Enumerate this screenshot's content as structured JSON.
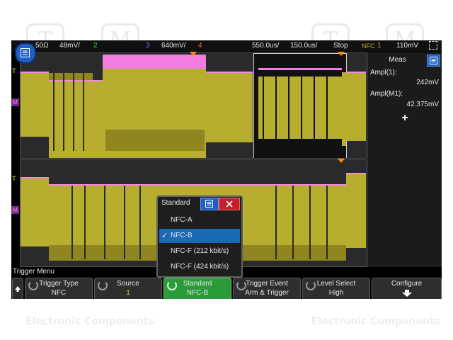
{
  "status": {
    "ch1_num": "1",
    "impedance": "50Ω",
    "ch1_scale": "48mV/",
    "ch2": "2",
    "ch3": "3",
    "ch4_scale": "640mV/",
    "ch4": "4",
    "time_pos": "550.0us/",
    "time_div": "150.0us/",
    "run_state": "Stop",
    "trig_mode": "NFC",
    "trig_src": "1",
    "trig_level": "110mV"
  },
  "meas": {
    "title": "Meas",
    "m1_label": "Ampl(1):",
    "m1_value": "242mV",
    "m2_label": "Ampl(M1):",
    "m2_value": "42.375mV",
    "add": "+"
  },
  "dialog": {
    "title": "Standard",
    "options": [
      "NFC-A",
      "NFC-B",
      "NFC-F (212 kbit/s)",
      "NFC-F (424 kbit/s)"
    ],
    "selected": "NFC-B",
    "check": "✓"
  },
  "trigger_menu": {
    "title": "Trigger Menu",
    "softkeys": [
      {
        "label": "Trigger Type",
        "value": "NFC"
      },
      {
        "label": "Source",
        "value": "1"
      },
      {
        "label": "Standard",
        "value": "NFC-B"
      },
      {
        "label": "Trigger Event",
        "value": "Arm & Trigger"
      },
      {
        "label": "Level Select",
        "value": "High"
      },
      {
        "label": "Configure",
        "value": ""
      }
    ]
  },
  "markers": {
    "ch_marker_top": "T",
    "ch_marker_bottom": "T",
    "math_marker": "M"
  },
  "watermark": {
    "text": "Electronic Components",
    "letter_t": "T",
    "letter_m": "M"
  },
  "colors": {
    "ch1": "#b7ad2f",
    "math": "#f28be0",
    "accent": "#1f5fc4",
    "selected": "#1a6ab5",
    "active_key": "#2b9a3a",
    "trigger": "#ff8800"
  }
}
